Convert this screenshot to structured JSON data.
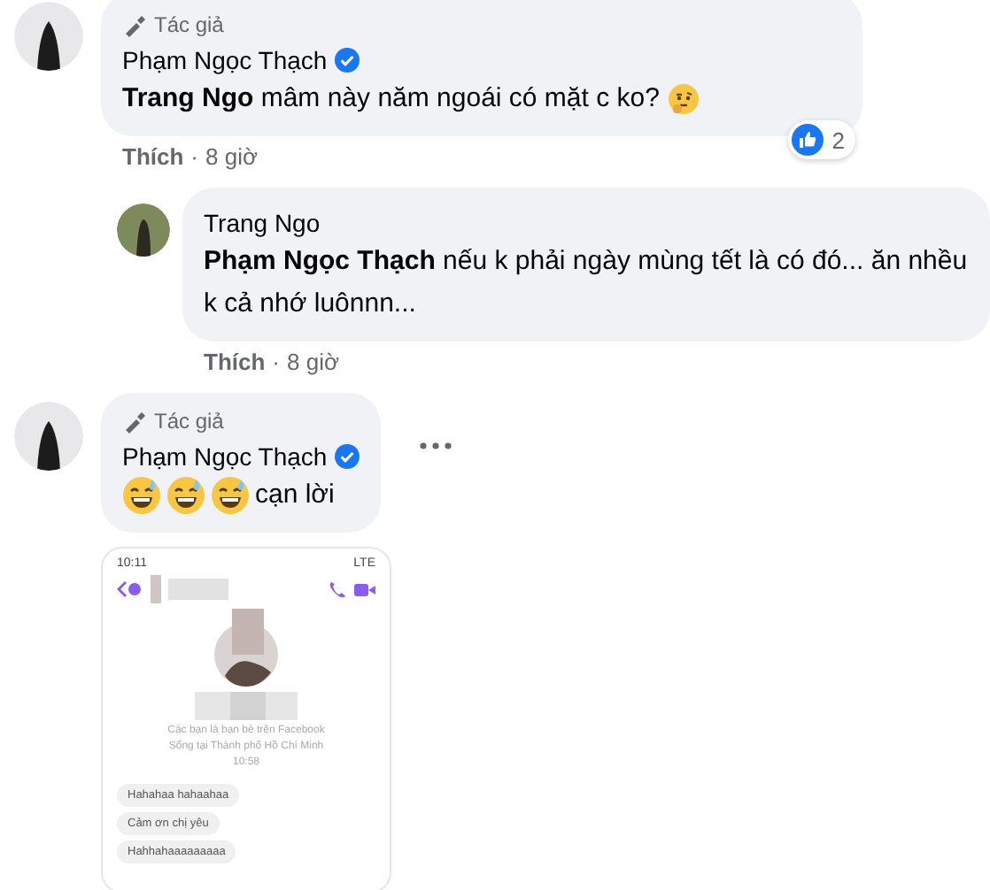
{
  "comments": [
    {
      "author": "Phạm Ngọc Thạch",
      "author_badge": "Tác giả",
      "verified": true,
      "reply": false,
      "mention": "Trang Ngo",
      "text": "mâm này năm ngoái có mặt c ko?",
      "emojis_after": [
        {
          "kind": "thinking"
        }
      ],
      "actions": {
        "like": "Thích",
        "separator": "·",
        "time": "8 giờ"
      },
      "reactions": {
        "count": "2"
      },
      "more": false
    },
    {
      "author": "Trang Ngo",
      "verified": false,
      "reply": true,
      "mention": "Phạm Ngọc Thạch",
      "text": "nếu k phải ngày mùng tết là có đó... ăn nhều k cả nhớ luônnn...",
      "actions": {
        "like": "Thích",
        "separator": "·",
        "time": "8 giờ"
      },
      "more": false
    },
    {
      "author": "Phạm Ngọc Thạch",
      "author_badge": "Tác giả",
      "verified": true,
      "reply": false,
      "text": "cạn lời",
      "emojis_before": [
        {
          "kind": "sweat-smile"
        },
        {
          "kind": "sweat-smile"
        },
        {
          "kind": "sweat-smile"
        }
      ],
      "more": true,
      "attachment": {
        "kind": "chat-screenshot",
        "status_time": "10:11",
        "network": "LTE",
        "profile_line_1": "Các bạn là bạn bè trên Facebook",
        "profile_line_2": "Sống tại Thành phố Hồ Chí Minh",
        "message_time": "10:58",
        "messages": [
          "Hahahaa hahaahaa",
          "Cảm ơn chị yêu",
          "Hahhahaaaaaaaaa"
        ]
      }
    }
  ]
}
